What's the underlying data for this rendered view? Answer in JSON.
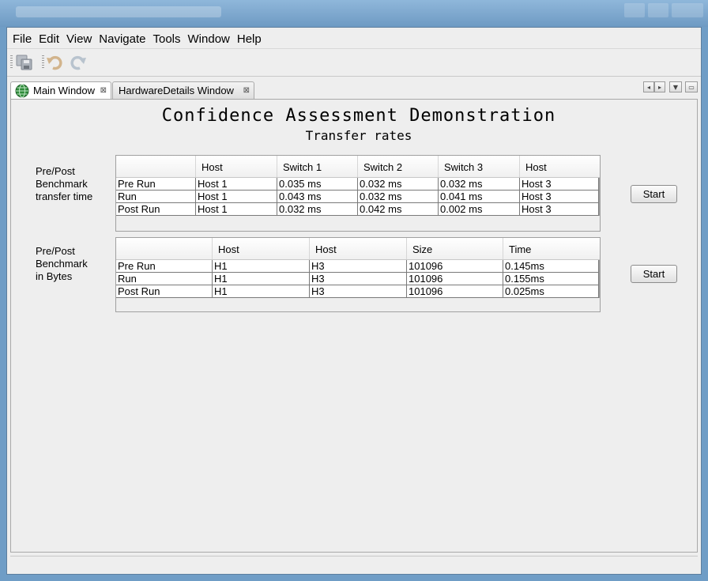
{
  "menu": [
    "File",
    "Edit",
    "View",
    "Navigate",
    "Tools",
    "Window",
    "Help"
  ],
  "toolbar": {
    "icons": [
      "save-all-icon",
      "undo-icon",
      "redo-icon"
    ]
  },
  "tabs": [
    {
      "label": "Main Window",
      "active": true,
      "icon": "globe-icon"
    },
    {
      "label": "HardwareDetails Window",
      "active": false
    }
  ],
  "page": {
    "title": "Confidence Assessment Demonstration",
    "subtitle": "Transfer rates"
  },
  "section1": {
    "label": [
      "Pre/Post",
      "Benchmark",
      "transfer time"
    ],
    "columns": [
      "",
      "Host",
      "Switch 1",
      "Switch 2",
      "Switch 3",
      "Host"
    ],
    "rows": [
      [
        "Pre Run",
        "Host 1",
        "0.035 ms",
        "0.032 ms",
        "0.032 ms",
        "Host 3"
      ],
      [
        "Run",
        "Host 1",
        "0.043 ms",
        "0.032 ms",
        "0.041 ms",
        "Host 3"
      ],
      [
        "Post Run",
        "Host 1",
        "0.032 ms",
        "0.042 ms",
        "0.002 ms",
        "Host 3"
      ]
    ],
    "button": "Start"
  },
  "section2": {
    "label": [
      "Pre/Post",
      "Benchmark",
      "in Bytes"
    ],
    "columns": [
      "",
      "Host",
      "Host",
      "Size",
      "Time"
    ],
    "rows": [
      [
        "Pre Run",
        "H1",
        "H3",
        "101096",
        "0.145ms"
      ],
      [
        "Run",
        "H1",
        "H3",
        "101096",
        "0.155ms"
      ],
      [
        "Post Run",
        "H1",
        "H3",
        "101096",
        "0.025ms"
      ]
    ],
    "button": "Start"
  }
}
